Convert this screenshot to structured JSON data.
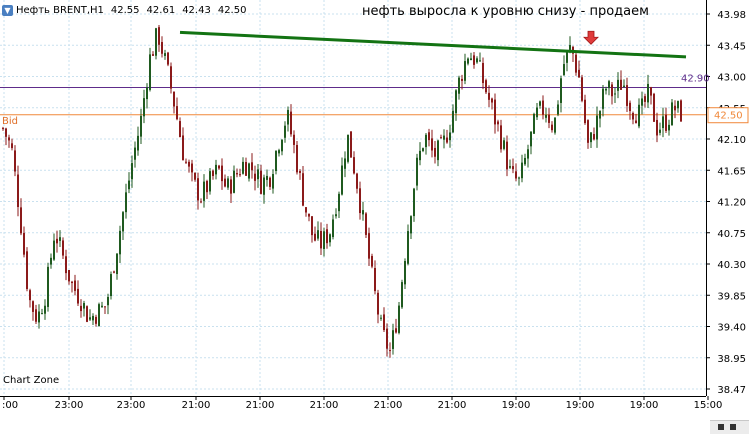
{
  "header": {
    "symbol": "Нефть BRENT,H1",
    "open": "42.55",
    "high": "42.61",
    "low": "42.43",
    "close": "42.50"
  },
  "annotation": "нефть выросла к уровню снизу - продаем",
  "watermark": "Chart Zone",
  "bid_label": "Bid",
  "colors": {
    "bull": "#1f5a1f",
    "bear": "#8b1a1a",
    "trendline": "#137313",
    "level_line": "#5e2c8a",
    "bid_line": "#f0883a",
    "marker": "#e03b3b",
    "grid": "#c9e1ef"
  },
  "chart_data": {
    "type": "candlestick",
    "ylim": [
      38.47,
      43.98
    ],
    "y_ticks": [
      "43.98",
      "43.45",
      "43.00",
      "42.55",
      "42.10",
      "41.65",
      "41.20",
      "40.75",
      "40.30",
      "39.85",
      "39.40",
      "38.95",
      "38.47"
    ],
    "x_ticks": [
      ":00",
      "23:00",
      "23:00",
      "21:00",
      "21:00",
      "21:00",
      "21:00",
      "21:00",
      "19:00",
      "19:00",
      "19:00",
      "15:00"
    ],
    "level_price": 42.9,
    "level_label": "42.90",
    "bid_price": 42.5,
    "bid_label": "42.50",
    "trendline_prices": [
      43.71,
      43.35
    ],
    "marker_price": 43.55,
    "path": [
      42.3,
      42.0,
      41.0,
      39.8,
      39.5,
      39.9,
      40.8,
      40.4,
      40.0,
      39.8,
      39.5,
      39.6,
      39.7,
      40.4,
      41.1,
      41.8,
      42.4,
      43.3,
      43.7,
      43.2,
      42.6,
      41.9,
      41.5,
      41.3,
      41.5,
      41.7,
      41.4,
      41.6,
      41.8,
      41.7,
      41.5,
      41.6,
      42.1,
      42.5,
      41.9,
      41.2,
      40.7,
      40.6,
      40.8,
      41.4,
      42.2,
      41.6,
      40.8,
      40.0,
      39.3,
      39.0,
      39.7,
      40.8,
      41.7,
      42.2,
      41.9,
      42.0,
      42.4,
      43.0,
      43.4,
      43.3,
      42.9,
      42.5,
      42.1,
      41.6,
      41.5,
      42.0,
      42.5,
      42.6,
      42.3,
      43.2,
      43.5,
      43.0,
      42.0,
      42.4,
      42.9,
      42.8,
      43.0,
      42.6,
      42.5,
      42.8,
      42.3,
      42.4,
      42.6,
      42.5
    ]
  }
}
